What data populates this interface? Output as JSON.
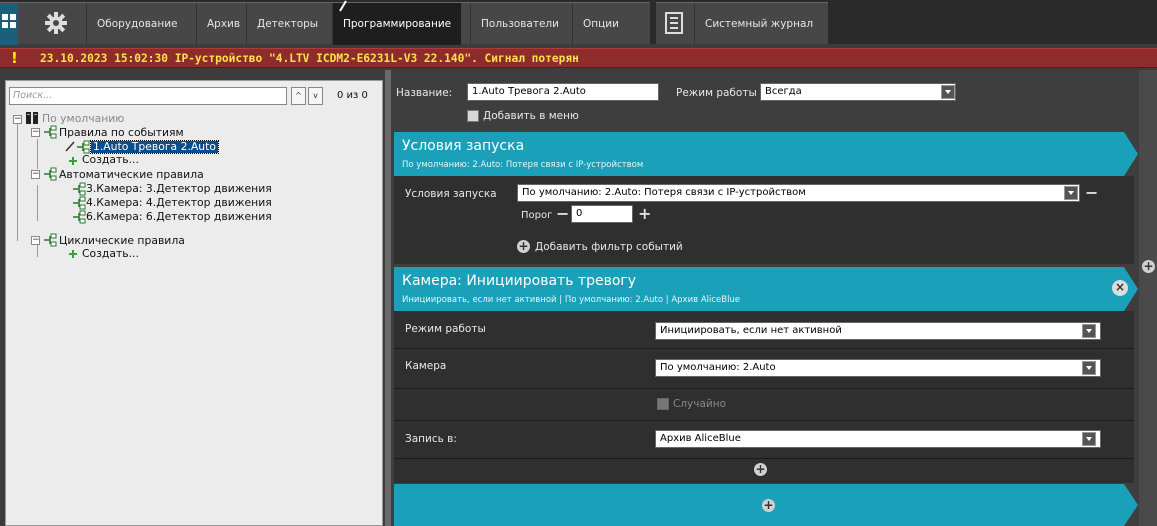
{
  "nav": {
    "tabs": [
      "Оборудование",
      "Архив",
      "Детекторы",
      "Программирование",
      "Пользователи",
      "Опции"
    ],
    "journal": "Системный журнал",
    "home_icon": "grid-icon",
    "gear_icon": "gear-icon",
    "journal_icon": "journal-icon"
  },
  "alert": {
    "icon": "!",
    "text": "23.10.2023 15:02:30 IP-устройство \"4.LTV ICDM2-E6231L-V3 22.140\". Сигнал потерян"
  },
  "left": {
    "search_placeholder": "Поиск...",
    "prev": "^",
    "next": "v",
    "count": "0 из 0",
    "tree": {
      "root": "По умолчанию",
      "event_rules": "Правила по событиям",
      "event_rule_1": "1.Auto Тревога 2.Auto",
      "create_1": "Создать...",
      "auto_rules": "Автоматические правила",
      "auto_rule_1": "3.Камера: 3.Детектор движения",
      "auto_rule_2": "4.Камера: 4.Детектор движения",
      "auto_rule_3": "6.Камера: 6.Детектор движения",
      "cyclic_rules": "Циклические правила",
      "create_2": "Создать..."
    }
  },
  "right": {
    "name_label": "Название:",
    "name_value": "1.Auto Тревога 2.Auto",
    "mode_label": "Режим работы",
    "mode_value": "Всегда",
    "add_menu": "Добавить в меню",
    "trigger": {
      "title": "Условия запуска",
      "subtitle": "По умолчанию: 2.Auto: Потеря связи с IP-устройством",
      "cond_label": "Условия запуска",
      "cond_value": "По умолчанию: 2.Auto: Потеря связи с IP-устройством",
      "threshold_label": "Порог",
      "threshold_value": "0",
      "add_filter": "Добавить фильтр событий"
    },
    "action": {
      "title": "Камера: Инициировать тревогу",
      "subtitle": "Инициировать, если нет активной | По умолчанию: 2.Auto | Архив AliceBlue",
      "mode_label": "Режим работы",
      "mode_value": "Инициировать, если нет активной",
      "camera_label": "Камера",
      "camera_value": "По умолчанию: 2.Auto",
      "random_label": "Случайно",
      "record_label": "Запись в:",
      "record_value": "Архив AliceBlue"
    }
  },
  "colors": {
    "accent": "#1aa0b8",
    "alert_bg": "#8e2b2b",
    "alert_text": "#ffe24a",
    "selected": "#0a4e8c"
  }
}
